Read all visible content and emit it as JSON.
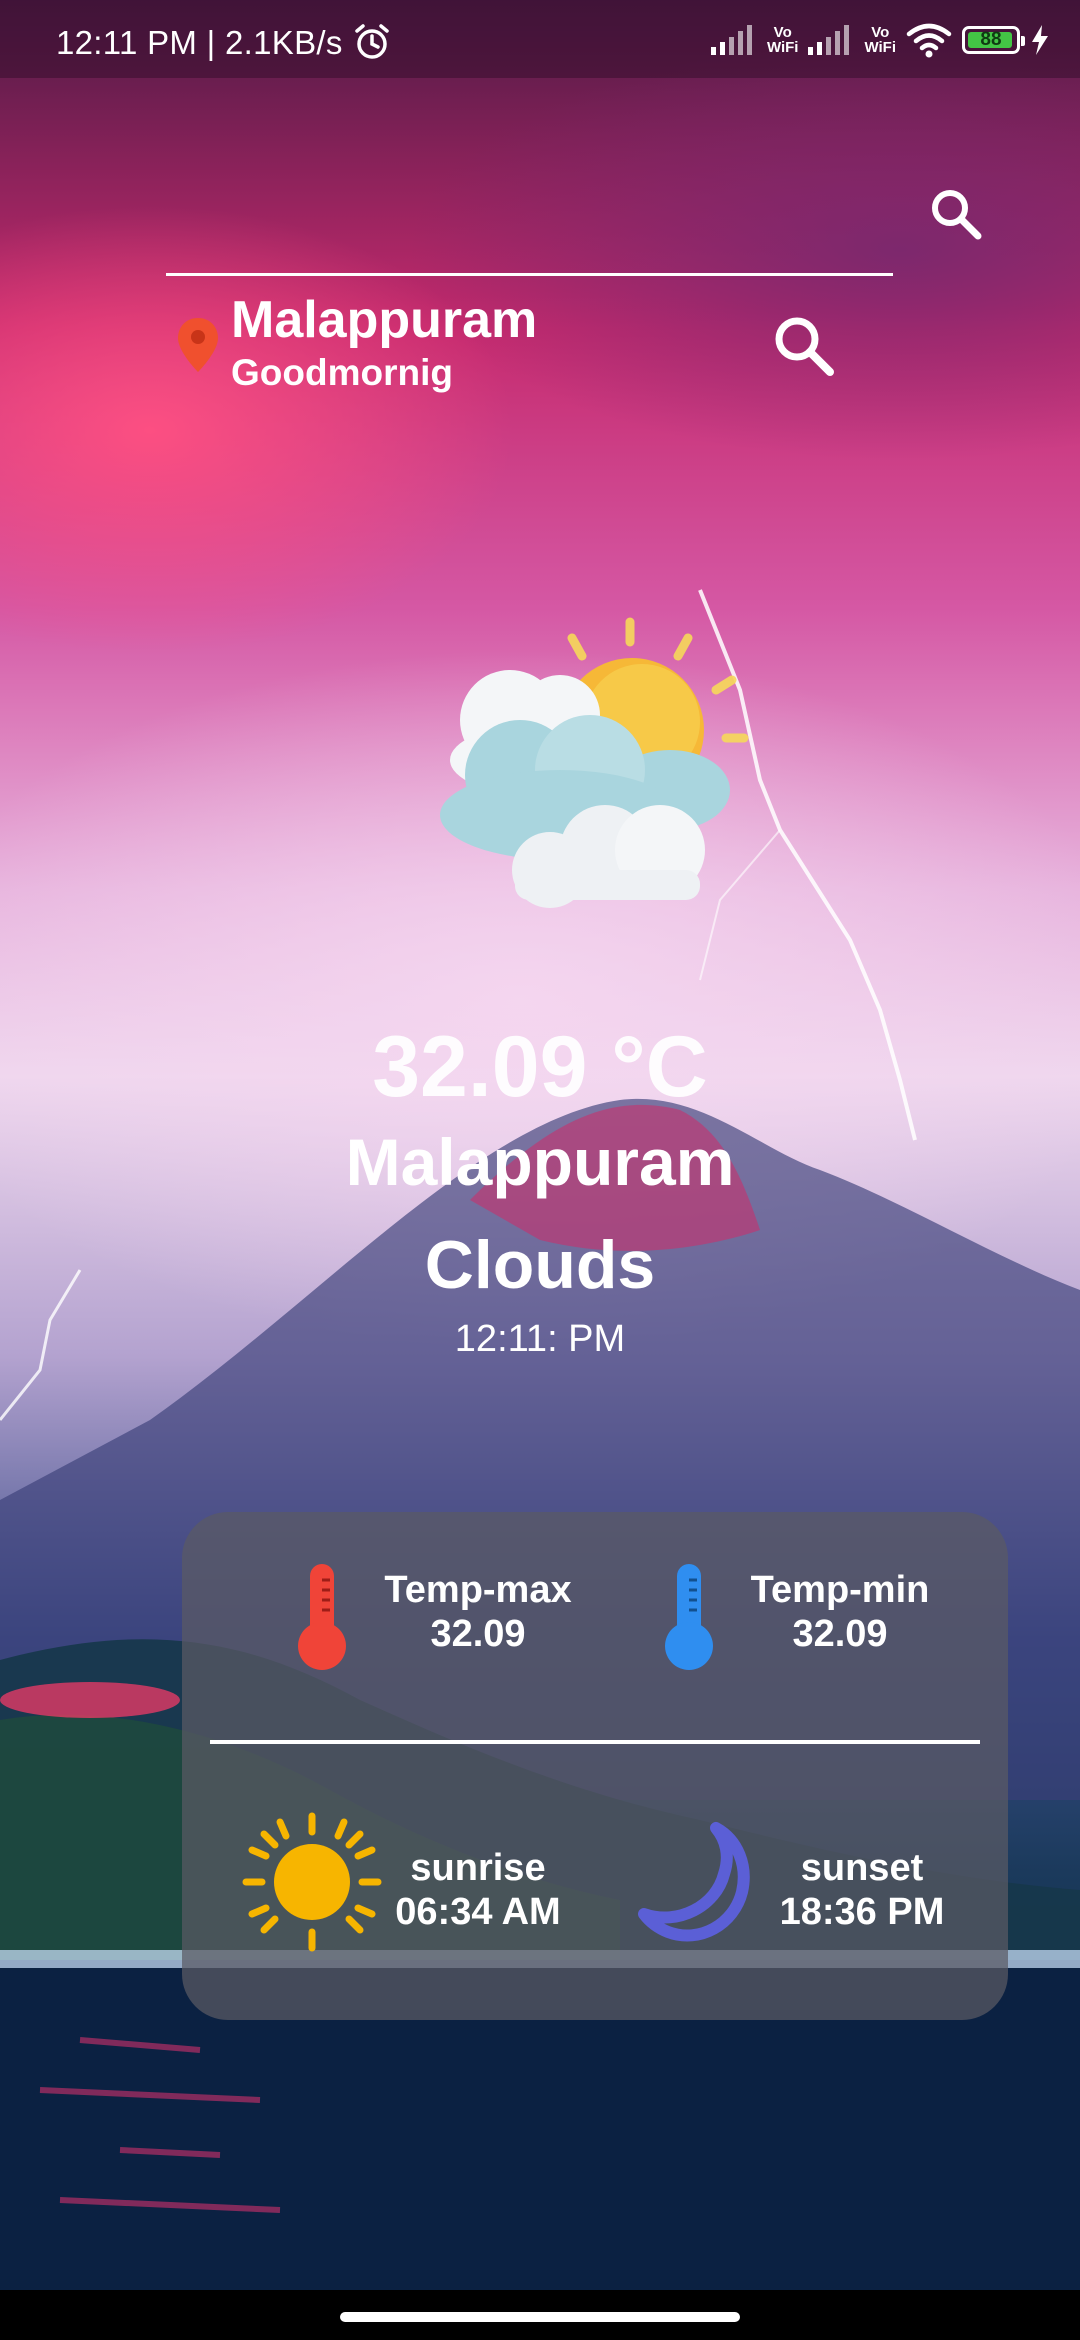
{
  "status_bar": {
    "time": "12:11 PM | 2.1KB/s",
    "vo_wifi_1": "Vo\nWiFi",
    "vo_wifi_2": "Vo\nWiFi",
    "battery": "88"
  },
  "header": {
    "city": "Malappuram",
    "greeting": "Goodmornig"
  },
  "weather": {
    "temperature": "32.09 °C",
    "city": "Malappuram",
    "condition": "Clouds",
    "time": "12:11: PM"
  },
  "details": {
    "temp_max_label": "Temp-max",
    "temp_max_value": "32.09",
    "temp_min_label": "Temp-min",
    "temp_min_value": "32.09",
    "sunrise_label": "sunrise",
    "sunrise_value": "06:34 AM",
    "sunset_label": "sunset",
    "sunset_value": "18:36 PM"
  },
  "colors": {
    "temp_max_icon": "#f04438",
    "temp_min_icon": "#2f8ef0",
    "sun_icon": "#f7b500",
    "moon_icon": "#5b5fd6",
    "location_pin": "#f0502e"
  }
}
